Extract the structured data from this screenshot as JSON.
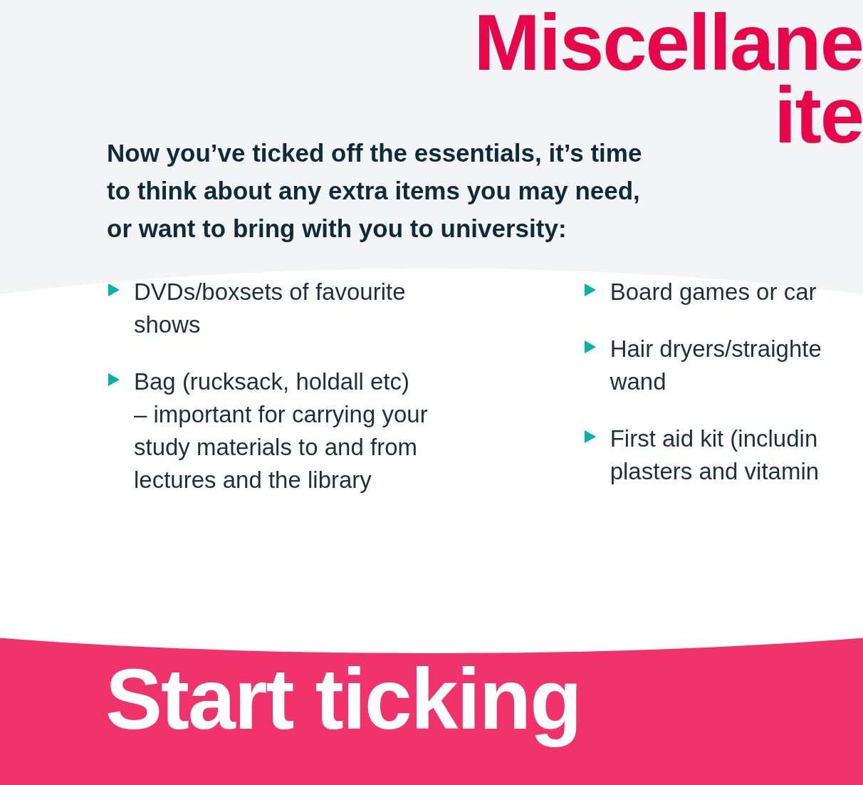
{
  "heading": {
    "line_1": "Miscellane",
    "line_2": "ite"
  },
  "intro": "Now you’ve ticked off the essentials, it’s time to think about any extra items you may need, or want to bring with you to university:",
  "columns": [
    {
      "items": [
        {
          "lines": [
            "DVDs/boxsets of favourite",
            "shows"
          ]
        },
        {
          "lines": [
            "Bag (rucksack, holdall etc)",
            "– important for carrying your",
            "study materials to and from",
            "lectures and the library"
          ]
        }
      ]
    },
    {
      "items": [
        {
          "lines": [
            "Board games or car"
          ]
        },
        {
          "lines": [
            "Hair dryers/straighte",
            "wand"
          ]
        },
        {
          "lines": [
            "First aid kit (includin",
            "plasters and vitamin"
          ]
        }
      ]
    }
  ],
  "footer": {
    "title": "Start ticking"
  }
}
